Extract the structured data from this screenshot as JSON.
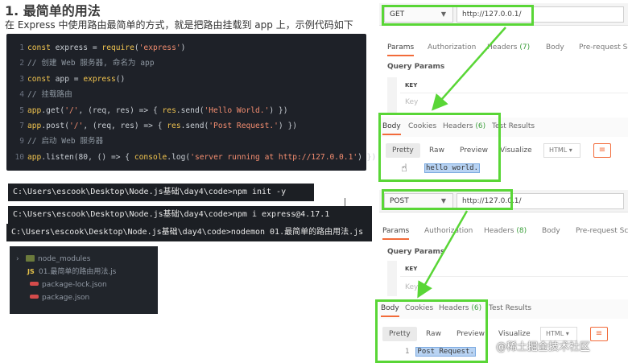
{
  "heading": "1. 最简单的用法",
  "intro": "在 Express 中使用路由最简单的方式，就是把路由挂载到 app 上，示例代码如下",
  "code_lines": [
    {
      "n": "1",
      "parts": [
        [
          "kw",
          "const "
        ],
        [
          "pl",
          "express = "
        ],
        [
          "fn",
          "require"
        ],
        [
          "pl",
          "("
        ],
        [
          "str",
          "'express'"
        ],
        [
          "pl",
          ")"
        ]
      ]
    },
    {
      "n": "2",
      "parts": [
        [
          "cm",
          "// 创建 Web 服务器, 命名为 app"
        ]
      ]
    },
    {
      "n": "3",
      "parts": [
        [
          "kw",
          "const "
        ],
        [
          "pl",
          "app = "
        ],
        [
          "fn",
          "express"
        ],
        [
          "pl",
          "()"
        ]
      ]
    },
    {
      "n": "4",
      "parts": [
        [
          "cm",
          "// 挂载路由"
        ]
      ]
    },
    {
      "n": "5",
      "parts": [
        [
          "fn",
          "app"
        ],
        [
          "pl",
          ".get("
        ],
        [
          "str",
          "'/'"
        ],
        [
          "pl",
          ", (req, res) => { "
        ],
        [
          "fn",
          "res"
        ],
        [
          "pl",
          ".send("
        ],
        [
          "str",
          "'Hello World.'"
        ],
        [
          "pl",
          ") })"
        ]
      ]
    },
    {
      "n": "7",
      "parts": [
        [
          "fn",
          "app"
        ],
        [
          "pl",
          ".post("
        ],
        [
          "str",
          "'/'"
        ],
        [
          "pl",
          ", (req, res) => { "
        ],
        [
          "fn",
          "res"
        ],
        [
          "pl",
          ".send("
        ],
        [
          "str",
          "'Post Request.'"
        ],
        [
          "pl",
          ") })"
        ]
      ]
    },
    {
      "n": "9",
      "parts": [
        [
          "cm",
          "// 启动 Web 服务器"
        ]
      ]
    },
    {
      "n": "10",
      "parts": [
        [
          "fn",
          "app"
        ],
        [
          "pl",
          ".listen(80, () => { "
        ],
        [
          "fn",
          "console"
        ],
        [
          "pl",
          ".log("
        ],
        [
          "str",
          "'server running at http://127.0.0.1'"
        ],
        [
          "pl",
          ") })"
        ]
      ]
    }
  ],
  "terminal": {
    "line1": "C:\\Users\\escook\\Desktop\\Node.js基础\\day4\\code>npm init -y",
    "line2": "C:\\Users\\escook\\Desktop\\Node.js基础\\day4\\code>npm i express@4.17.1",
    "line3": "C:\\Users\\escook\\Desktop\\Node.js基础\\day4\\code>nodemon 01.最简单的路由用法.js"
  },
  "file_tree": {
    "folder": "node_modules",
    "js_badge": "JS",
    "file_js": "01.最简单的路由用法.js",
    "file_lock": "package-lock.json",
    "file_pkg": "package.json"
  },
  "postman_get": {
    "method": "GET",
    "url": "http://127.0.0.1/",
    "tabs": [
      "Params",
      "Authorization",
      "Headers",
      "(7)",
      "Body",
      "Pre-request Scr"
    ],
    "query_params": "Query Params",
    "key_header": "KEY",
    "key_placeholder": "Key",
    "resp_tabs": [
      "Body",
      "Cookies",
      "Headers",
      "(6)",
      "Test Results"
    ],
    "formats": [
      "Pretty",
      "Raw",
      "Preview",
      "Visualize",
      "HTML"
    ],
    "body_text": "hello world."
  },
  "postman_post": {
    "method": "POST",
    "url": "http://127.0.0.1/",
    "tabs": [
      "Params",
      "Authorization",
      "Headers",
      "(8)",
      "Body",
      "Pre-request Scri"
    ],
    "query_params": "Query Params",
    "key_header": "KEY",
    "key_placeholder": "Key",
    "resp_tabs": [
      "Body",
      "Cookies",
      "Headers",
      "(6)",
      "Test Results"
    ],
    "formats": [
      "Pretty",
      "Raw",
      "Preview",
      "Visualize",
      "HTML"
    ],
    "body_line_num": "1",
    "body_text": "Post Request."
  },
  "watermark": "@稀土掘金技术社区",
  "colors": {
    "highlight": "#59d636",
    "accent": "#f26b3a"
  }
}
